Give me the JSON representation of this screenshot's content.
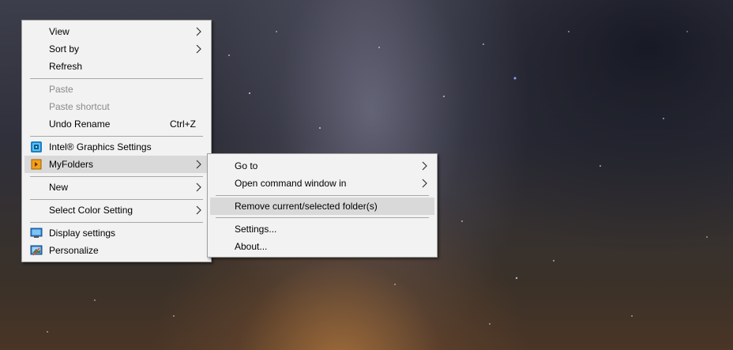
{
  "main_menu": {
    "view": "View",
    "sort_by": "Sort by",
    "refresh": "Refresh",
    "paste": "Paste",
    "paste_shortcut": "Paste shortcut",
    "undo_rename": "Undo Rename",
    "undo_shortcut": "Ctrl+Z",
    "intel_graphics": "Intel® Graphics Settings",
    "myfolders": "MyFolders",
    "new": "New",
    "select_color": "Select Color Setting",
    "display_settings": "Display settings",
    "personalize": "Personalize"
  },
  "sub_menu": {
    "go_to": "Go to",
    "open_command": "Open command window in",
    "remove_folder": "Remove current/selected folder(s)",
    "settings": "Settings...",
    "about": "About..."
  },
  "icons": {
    "submenu_arrow": "chevron-right-icon",
    "intel": "intel-graphics-icon",
    "myfolders": "myfolders-icon",
    "display": "display-settings-icon",
    "personalize": "personalize-icon"
  },
  "colors": {
    "menu_background": "#f2f2f2",
    "menu_border": "#a0a0a0",
    "highlight": "#d9d9d9",
    "disabled_text": "#8a8a8a",
    "separator": "#a8a8a8"
  }
}
